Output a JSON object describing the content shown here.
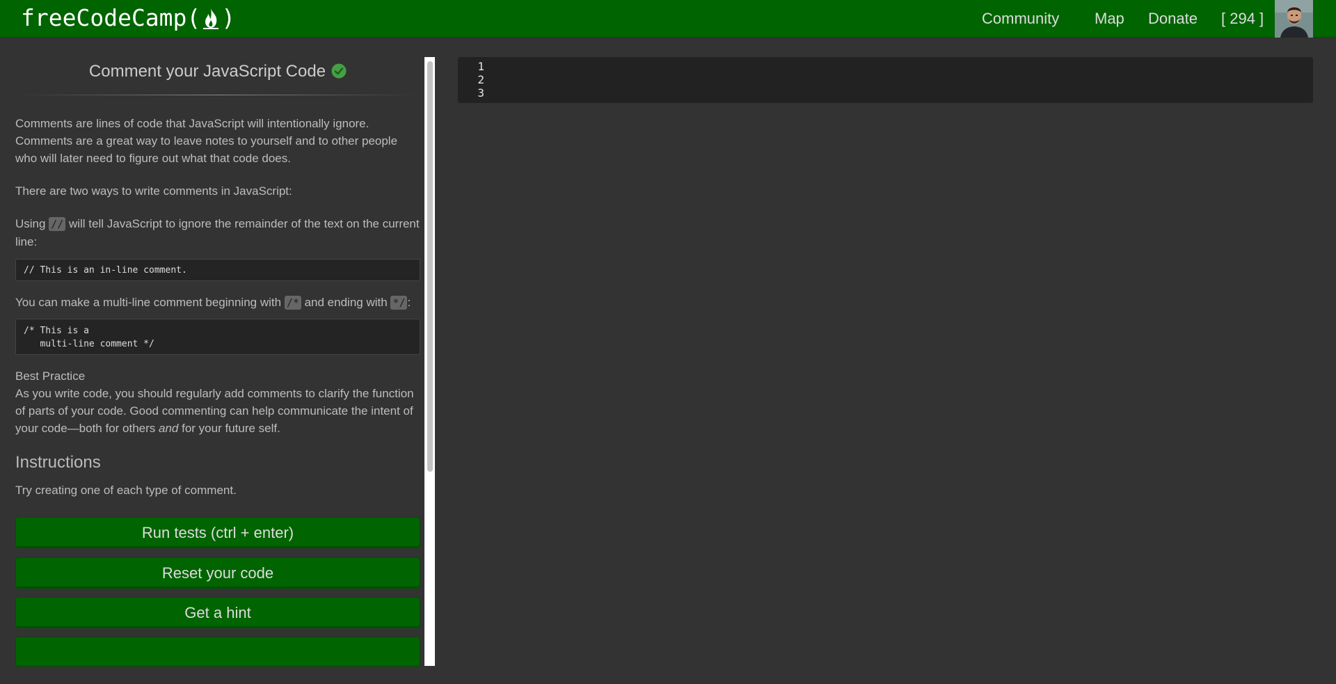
{
  "navbar": {
    "logo_text_left": "freeCodeCamp(",
    "logo_text_right": ")",
    "links": {
      "community": "Community",
      "map": "Map",
      "donate": "Donate",
      "points": "[ 294 ]"
    },
    "bg_color": "#006400"
  },
  "challenge": {
    "title": "Comment your JavaScript Code",
    "completed_icon": "check-circle-icon",
    "intro": "Comments are lines of code that JavaScript will intentionally ignore. Comments are a great way to leave notes to yourself and to other people who will later need to figure out what that code does.",
    "two_ways": "There are two ways to write comments in JavaScript:",
    "using_prefix": "Using ",
    "using_code": "//",
    "using_suffix": " will tell JavaScript to ignore the remainder of the text on the current line:",
    "inline_example": "// This is an in-line comment.",
    "multi_prefix": "You can make a multi-line comment beginning with ",
    "multi_code_start": "/*",
    "multi_middle": " and ending with ",
    "multi_code_end": "*/",
    "multi_suffix": ":",
    "multiline_example": "/* This is a\n   multi-line comment */",
    "best_practice_heading": "Best Practice",
    "best_practice_text_1": "As you write code, you should regularly add comments to clarify the function of parts of your code. Good commenting can help communicate the intent of your code—both for others ",
    "best_practice_em": "and",
    "best_practice_text_2": " for your future self.",
    "instructions_heading": "Instructions",
    "instructions_text": "Try creating one of each type of comment."
  },
  "buttons": {
    "run_tests": "Run tests (ctrl + enter)",
    "reset_code": "Reset your code",
    "get_hint": "Get a hint"
  },
  "editor": {
    "line_numbers": [
      "1",
      "2",
      "3"
    ]
  }
}
